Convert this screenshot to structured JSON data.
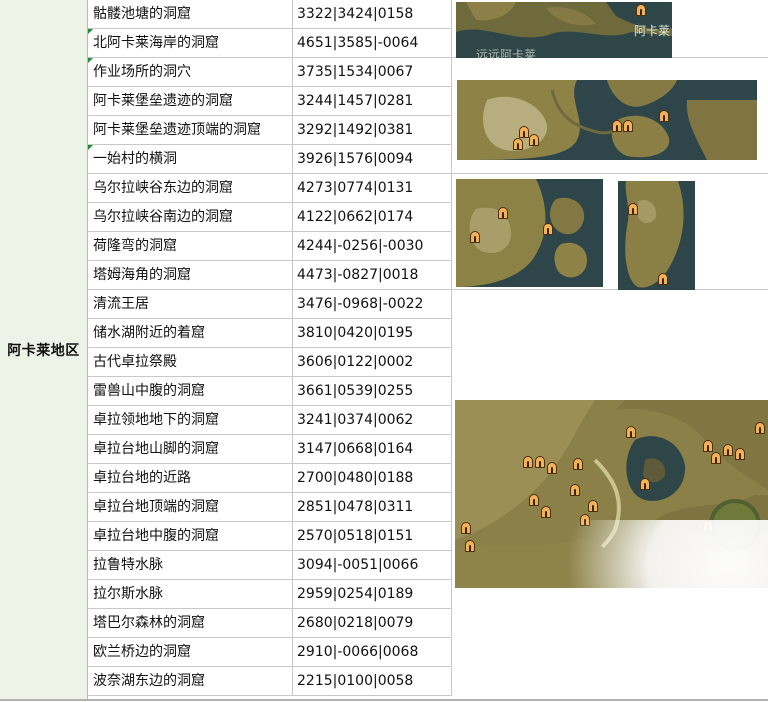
{
  "region": "阿卡莱地区",
  "rows": [
    {
      "name": "骷髅池塘的洞窟",
      "coord": "3322|3424|0158"
    },
    {
      "name": " 北阿卡莱海岸的洞窟",
      "coord": "4651|3585|-0064"
    },
    {
      "name": " 作业场所的洞穴",
      "coord": "3735|1534|0067"
    },
    {
      "name": "阿卡莱堡垒遗迹的洞窟",
      "coord": "3244|1457|0281"
    },
    {
      "name": "阿卡莱堡垒遗迹顶端的洞窟",
      "coord": "3292|1492|0381"
    },
    {
      "name": " 一始村的横洞",
      "coord": "3926|1576|0094"
    },
    {
      "name": "乌尔拉峡谷东边的洞窟",
      "coord": "4273|0774|0131"
    },
    {
      "name": "乌尔拉峡谷南边的洞窟",
      "coord": "4122|0662|0174"
    },
    {
      "name": "荷隆弯的洞窟",
      "coord": "4244|-0256|-0030"
    },
    {
      "name": "塔姆海角的洞窟",
      "coord": "4473|-0827|0018"
    },
    {
      "name": "清流王居",
      "coord": "3476|-0968|-0022"
    },
    {
      "name": "储水湖附近的着窟",
      "coord": "3810|0420|0195"
    },
    {
      "name": "古代卓拉祭殿",
      "coord": "3606|0122|0002"
    },
    {
      "name": "雷兽山中腹的洞窟",
      "coord": "3661|0539|0255"
    },
    {
      "name": "卓拉领地地下的洞窟",
      "coord": "3241|0374|0062"
    },
    {
      "name": "卓拉台地山脚的洞窟",
      "coord": "3147|0668|0164"
    },
    {
      "name": "卓拉台地的近路",
      "coord": "2700|0480|0188"
    },
    {
      "name": "卓拉台地顶端的洞窟",
      "coord": "2851|0478|0311"
    },
    {
      "name": "卓拉台地中腹的洞窟",
      "coord": "2570|0518|0151"
    },
    {
      "name": "拉鲁特水脉",
      "coord": "3094|-0051|0066"
    },
    {
      "name": "拉尔斯水脉",
      "coord": "2959|0254|0189"
    },
    {
      "name": "塔巴尔森林的洞窟",
      "coord": "2680|0218|0079"
    },
    {
      "name": "欧兰桥边的洞窟",
      "coord": "2910|-0066|0068"
    },
    {
      "name": "波奈湖东边的洞窟",
      "coord": "2215|0100|0058"
    }
  ],
  "map_labels": {
    "map1_a": "阿卡莱",
    "map1_b": "远远阿卡莱"
  },
  "colors": {
    "region_bg": "#eef3e7",
    "map_land": "#8a7d43",
    "map_water": "#2d4448",
    "cave_icon": "#f3b25a"
  }
}
